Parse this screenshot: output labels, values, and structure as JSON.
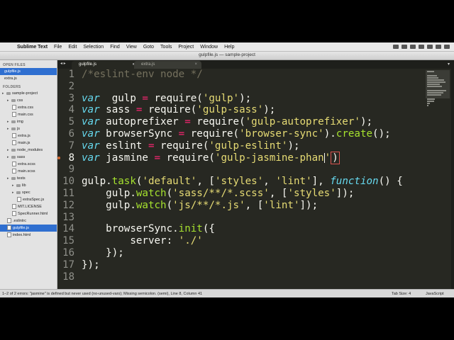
{
  "menubar": {
    "app_name": "Sublime Text",
    "items": [
      "File",
      "Edit",
      "Selection",
      "Find",
      "View",
      "Goto",
      "Tools",
      "Project",
      "Window",
      "Help"
    ]
  },
  "window": {
    "title": "gulpfile.js — sample-project"
  },
  "tabs": [
    {
      "label": "gulpfile.js",
      "active": true
    },
    {
      "label": "extra.js",
      "active": false
    }
  ],
  "sidebar": {
    "open_files_heading": "OPEN FILES",
    "open_files": [
      "gulpfile.js",
      "extra.js"
    ],
    "folders_heading": "FOLDERS",
    "tree": [
      {
        "label": "sample-project",
        "depth": 0,
        "kind": "folder"
      },
      {
        "label": "css",
        "depth": 1,
        "kind": "folder"
      },
      {
        "label": "extra.css",
        "depth": 2,
        "kind": "file"
      },
      {
        "label": "main.css",
        "depth": 2,
        "kind": "file"
      },
      {
        "label": "img",
        "depth": 1,
        "kind": "folder"
      },
      {
        "label": "js",
        "depth": 1,
        "kind": "folder"
      },
      {
        "label": "extra.js",
        "depth": 2,
        "kind": "file"
      },
      {
        "label": "main.js",
        "depth": 2,
        "kind": "file"
      },
      {
        "label": "node_modules",
        "depth": 1,
        "kind": "folder"
      },
      {
        "label": "sass",
        "depth": 1,
        "kind": "folder"
      },
      {
        "label": "extra.scss",
        "depth": 2,
        "kind": "file"
      },
      {
        "label": "main.scss",
        "depth": 2,
        "kind": "file"
      },
      {
        "label": "tests",
        "depth": 1,
        "kind": "folder"
      },
      {
        "label": "lib",
        "depth": 2,
        "kind": "folder"
      },
      {
        "label": "spec",
        "depth": 2,
        "kind": "folder"
      },
      {
        "label": "extraSpec.js",
        "depth": 3,
        "kind": "file"
      },
      {
        "label": "MIT.LICENSE",
        "depth": 2,
        "kind": "file"
      },
      {
        "label": "SpecRunner.html",
        "depth": 2,
        "kind": "file"
      },
      {
        "label": ".eslintrc",
        "depth": 1,
        "kind": "file"
      },
      {
        "label": "gulpfile.js",
        "depth": 1,
        "kind": "file",
        "selected": true
      },
      {
        "label": "index.html",
        "depth": 1,
        "kind": "file"
      }
    ]
  },
  "editor": {
    "line_numbers": [
      "1",
      "2",
      "3",
      "4",
      "5",
      "6",
      "7",
      "8",
      "9",
      "10",
      "11",
      "12",
      "13",
      "14",
      "15",
      "16",
      "17",
      "18"
    ],
    "current_line": 8,
    "error_line": 8,
    "lines": [
      [
        [
          "cmt",
          "/*eslint-env node */"
        ]
      ],
      [],
      [
        [
          "kw",
          "var"
        ],
        [
          "",
          "  gulp "
        ],
        [
          "op",
          "="
        ],
        [
          "",
          " require("
        ],
        [
          "str",
          "'gulp'"
        ],
        [
          "",
          ");"
        ]
      ],
      [
        [
          "kw",
          "var"
        ],
        [
          "",
          " sass "
        ],
        [
          "op",
          "="
        ],
        [
          "",
          " require("
        ],
        [
          "str",
          "'gulp-sass'"
        ],
        [
          "",
          ");"
        ]
      ],
      [
        [
          "kw",
          "var"
        ],
        [
          "",
          " autoprefixer "
        ],
        [
          "op",
          "="
        ],
        [
          "",
          " require("
        ],
        [
          "str",
          "'gulp-autoprefixer'"
        ],
        [
          "",
          ");"
        ]
      ],
      [
        [
          "kw",
          "var"
        ],
        [
          "",
          " browserSync "
        ],
        [
          "op",
          "="
        ],
        [
          "",
          " require("
        ],
        [
          "str",
          "'browser-sync'"
        ],
        [
          "",
          ")."
        ],
        [
          "fn",
          "create"
        ],
        [
          "",
          "();"
        ]
      ],
      [
        [
          "kw",
          "var"
        ],
        [
          "",
          " eslint "
        ],
        [
          "op",
          "="
        ],
        [
          "",
          " require("
        ],
        [
          "str",
          "'gulp-eslint'"
        ],
        [
          "",
          ");"
        ]
      ],
      [
        [
          "kw",
          "var"
        ],
        [
          "",
          " jasmine "
        ],
        [
          "op",
          "="
        ],
        [
          "",
          " require("
        ],
        [
          "str",
          "'gulp-jasmine-phan"
        ],
        [
          "cursor",
          ""
        ],
        [
          "str",
          "'"
        ],
        [
          "err",
          ")"
        ]
      ],
      [],
      [
        [
          "",
          "gulp."
        ],
        [
          "fn",
          "task"
        ],
        [
          "",
          "("
        ],
        [
          "str",
          "'default'"
        ],
        [
          "",
          ", ["
        ],
        [
          "str",
          "'styles'"
        ],
        [
          "",
          ", "
        ],
        [
          "str",
          "'lint'"
        ],
        [
          "",
          "], "
        ],
        [
          "kw",
          "function"
        ],
        [
          "",
          "() {"
        ]
      ],
      [
        [
          "",
          "    gulp."
        ],
        [
          "fn",
          "watch"
        ],
        [
          "",
          "("
        ],
        [
          "str",
          "'sass/**/*.scss'"
        ],
        [
          "",
          ", ["
        ],
        [
          "str",
          "'styles'"
        ],
        [
          "",
          "]);"
        ]
      ],
      [
        [
          "",
          "    gulp."
        ],
        [
          "fn",
          "watch"
        ],
        [
          "",
          "("
        ],
        [
          "str",
          "'js/**/*.js'"
        ],
        [
          "",
          ", ["
        ],
        [
          "str",
          "'lint'"
        ],
        [
          "",
          "]);"
        ]
      ],
      [],
      [
        [
          "",
          "    browserSync."
        ],
        [
          "fn",
          "init"
        ],
        [
          "",
          "({"
        ]
      ],
      [
        [
          "",
          "        server: "
        ],
        [
          "str",
          "'./'"
        ]
      ],
      [
        [
          "",
          "    });"
        ]
      ],
      [
        [
          "",
          "});"
        ]
      ],
      []
    ]
  },
  "statusbar": {
    "message": "1–2 of 2 errors: \"jasmine\" is defined but never used (no-unused-vars); Missing semicolon. (semi), Line 8, Column 41",
    "tab_size": "Tab Size: 4",
    "syntax": "JavaScript"
  },
  "colors": {
    "background": "#272822",
    "keyword": "#66d9ef",
    "operator": "#f92672",
    "string": "#e6db74",
    "function": "#a6e22e",
    "comment": "#75715e",
    "selection": "#2f6fd0"
  },
  "icons": [
    "apple-icon",
    "close-icon",
    "folder-icon",
    "file-icon",
    "chevron-left-icon",
    "chevron-right-icon",
    "dropdown-icon"
  ]
}
